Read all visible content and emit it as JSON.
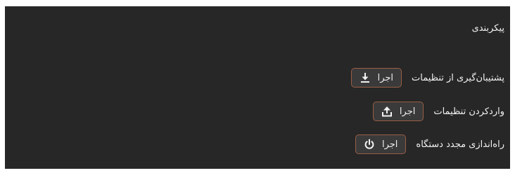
{
  "section": {
    "title": "پیکربندی"
  },
  "actions": [
    {
      "label": "پشتیبان‌گیری از تنظیمات",
      "button_label": "اجرا",
      "icon": "download-icon"
    },
    {
      "label": "واردکردن تنظیمات",
      "button_label": "اجرا",
      "icon": "upload-icon"
    },
    {
      "label": "راه‌اندازی مجدد دستگاه",
      "button_label": "اجرا",
      "icon": "power-icon"
    }
  ],
  "colors": {
    "panel_background": "#272727",
    "text": "#f2f2f2",
    "button_background": "#3a3a3a",
    "button_border": "#9a5e45"
  }
}
